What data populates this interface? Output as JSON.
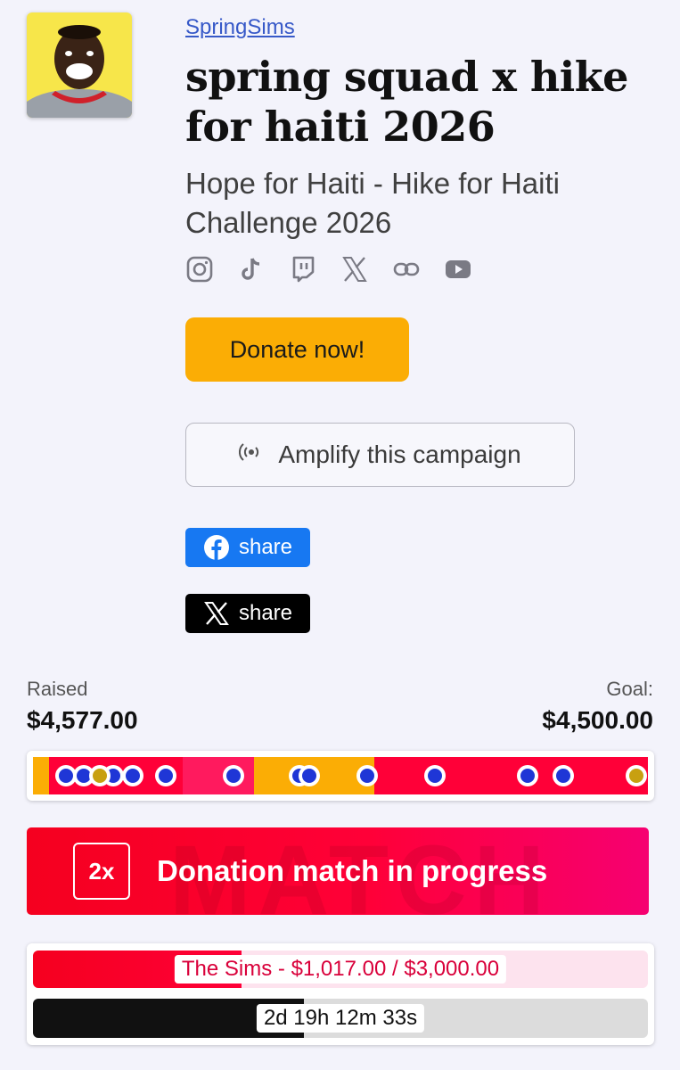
{
  "header": {
    "creator": "SpringSims",
    "title": "spring squad x hike for haiti 2026",
    "subtitle": "Hope for Haiti - Hike for Haiti Challenge 2026",
    "socials": [
      "instagram-icon",
      "tiktok-icon",
      "twitch-icon",
      "x-icon",
      "link-icon",
      "youtube-icon"
    ]
  },
  "actions": {
    "donate_label": "Donate now!",
    "amplify_label": "Amplify this campaign",
    "facebook_share_label": "share",
    "x_share_label": "share"
  },
  "progress": {
    "raised_label": "Raised",
    "raised_value": "$4,577.00",
    "goal_label": "Goal:",
    "goal_value": "$4,500.00"
  },
  "match": {
    "badge": "2x",
    "banner_text": "Donation match in progress",
    "watermark": "MATCH",
    "sponsor_progress": "The Sims - $1,017.00 / $3,000.00",
    "sponsor_fraction": 0.339,
    "time_remaining": "2d 19h 12m 33s",
    "time_fraction": 0.44
  },
  "colors": {
    "donate": "#fbad05",
    "facebook": "#1778f2",
    "match_red": "#ff0038",
    "link": "#3759c8"
  }
}
